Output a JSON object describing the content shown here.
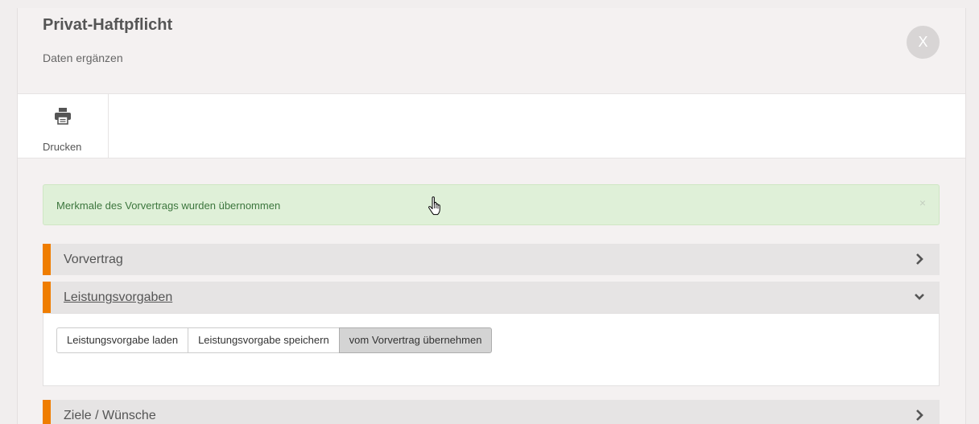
{
  "header": {
    "title": "Privat-Haftpflicht",
    "subtitle": "Daten ergänzen",
    "close_label": "X"
  },
  "toolbar": {
    "print_label": "Drucken",
    "print_icon": "printer-icon"
  },
  "alert": {
    "message": "Merkmale des Vorvertrags wurden übernommen",
    "close_symbol": "×",
    "color": "#dff0d8"
  },
  "accordion": {
    "accent_color": "#ef7d00",
    "sections": [
      {
        "label": "Vorvertrag",
        "state": "collapsed",
        "icon": "chevron-right-icon"
      },
      {
        "label": "Leistungsvorgaben",
        "state": "expanded",
        "icon": "chevron-down-icon"
      },
      {
        "label": "Ziele / Wünsche",
        "state": "collapsed",
        "icon": "chevron-right-icon"
      }
    ]
  },
  "leistungsvorgaben": {
    "buttons": [
      {
        "label": "Leistungsvorgabe laden"
      },
      {
        "label": "Leistungsvorgabe speichern"
      },
      {
        "label": "vom Vorvertrag übernehmen",
        "state": "pressed"
      }
    ]
  }
}
